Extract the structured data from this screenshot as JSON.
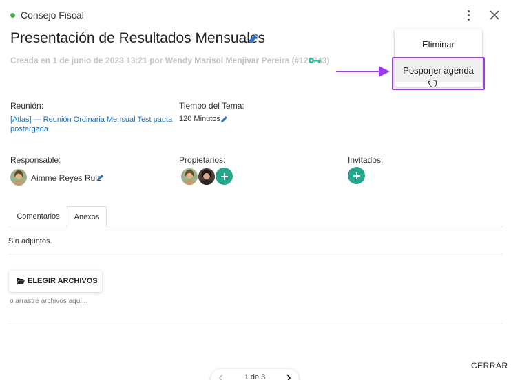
{
  "header": {
    "organization": "Consejo Fiscal",
    "status_color": "#4caf50"
  },
  "topic": {
    "title": "Presentación de Resultados Mensuales",
    "created_info": "Creada en 1 de junio de 2023 13:21 por Wendy Marisol Menjivar Pereira (#129743)"
  },
  "menu": {
    "items": [
      {
        "label": "Eliminar"
      },
      {
        "label": "Posponer agenda"
      }
    ],
    "highlight_color": "#9b3cf0"
  },
  "details": {
    "meeting_label": "Reunión:",
    "meeting_value_line1": "[Atlas] — Reunión Ordinaria Mensual Test pauta",
    "meeting_value_line2": "postergada",
    "time_label": "Tiempo del Tema:",
    "time_value": "120 Minutos",
    "responsible_label": "Responsable:",
    "responsible_name": "Aimme Reyes Ruiz",
    "owners_label": "Propietarios:",
    "guests_label": "Invitados:"
  },
  "tabs": [
    {
      "label": "Comentarios"
    },
    {
      "label": "Anexos"
    }
  ],
  "attachments": {
    "empty_text": "Sin adjuntos.",
    "choose_button": "ELEGIR ARCHIVOS",
    "drag_hint": "o arrastre archivos aquí..."
  },
  "footer": {
    "close_label": "CERRAR",
    "pagination": "1 de 3"
  },
  "colors": {
    "accent_green": "#26a68a",
    "link_blue": "#1a6fb5",
    "pencil_blue": "#2f74c0"
  }
}
